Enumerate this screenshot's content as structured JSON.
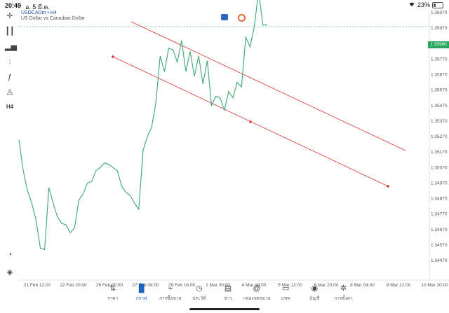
{
  "status": {
    "time": "20:49",
    "date": "อ. 5 มี.ค.",
    "battery": "23%",
    "battery_level": 0.23
  },
  "symbol": {
    "name": "USDCADm",
    "timeframe": "H4",
    "description": "US Dollar vs Canadian Dollar"
  },
  "price_current": "1.35980",
  "price_ticks": [
    "1.36070",
    "1.35970",
    "1.35870",
    "1.35770",
    "1.35670",
    "1.35570",
    "1.35470",
    "1.35370",
    "1.35270",
    "1.35170",
    "1.35070",
    "1.34970",
    "1.34870",
    "1.34770",
    "1.34670",
    "1.34570",
    "1.34470"
  ],
  "time_ticks": [
    "21 Feb 12:00",
    "22 Feb 20:00",
    "26 Feb 00:00",
    "27 Feb 08:00",
    "28 Feb 16:00",
    "1 Mar 00:00",
    "4 Mar 04:00",
    "5 Mar 12:00",
    "6 Mar 20:00",
    "8 Mar 04:00",
    "9 Mar 12:00",
    "10 Mar 20:00"
  ],
  "nav": [
    {
      "label": "ราคา",
      "icon": "quotes-icon"
    },
    {
      "label": "กราฟ",
      "icon": "chart-icon",
      "active": true
    },
    {
      "label": "การซื้อขาย",
      "icon": "trade-icon"
    },
    {
      "label": "ประวัติ",
      "icon": "history-icon"
    },
    {
      "label": "ข่าว",
      "icon": "news-icon"
    },
    {
      "label": "กล่องจดหมาย",
      "icon": "mailbox-icon"
    },
    {
      "label": "แชท",
      "icon": "chat-icon"
    },
    {
      "label": "บัญชี",
      "icon": "account-icon"
    },
    {
      "label": "การตั้งค่า",
      "icon": "settings-icon"
    }
  ],
  "chart_data": {
    "type": "line",
    "series_color": "#3aa776",
    "channel_color": "#e03030",
    "price_line": 1.3598,
    "ylim": [
      1.3438,
      1.3612
    ],
    "values": [
      1.3525,
      1.3505,
      1.3492,
      1.3484,
      1.3473,
      1.3455,
      1.3454,
      1.3494,
      1.3484,
      1.3475,
      1.3471,
      1.347,
      1.3465,
      1.3468,
      1.3486,
      1.349,
      1.3497,
      1.3498,
      1.3505,
      1.3507,
      1.351,
      1.3509,
      1.3507,
      1.3505,
      1.3495,
      1.3491,
      1.3489,
      1.3484,
      1.348,
      1.3518,
      1.3527,
      1.3533,
      1.3549,
      1.3579,
      1.3569,
      1.3584,
      1.3583,
      1.3575,
      1.3589,
      1.3569,
      1.3582,
      1.3566,
      1.3579,
      1.3561,
      1.3576,
      1.3547,
      1.3553,
      1.3552,
      1.3544,
      1.3556,
      1.3552,
      1.3562,
      1.3559,
      1.3591,
      1.3585,
      1.3598,
      1.3621,
      1.3599,
      1.3599
    ]
  }
}
